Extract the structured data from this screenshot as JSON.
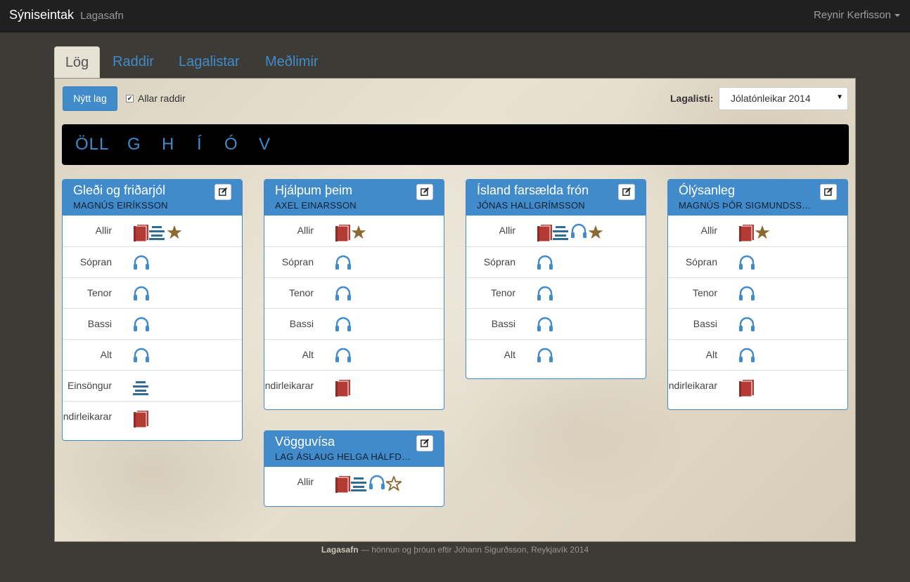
{
  "navbar": {
    "brand": "Sýniseintak",
    "subtitle": "Lagasafn",
    "user": "Reynir Kerfisson"
  },
  "tabs": [
    "Lög",
    "Raddir",
    "Lagalistar",
    "Meðlimir"
  ],
  "toolbar": {
    "new_song": "Nýtt lag",
    "all_voices": "Allar raddir",
    "all_voices_checked": true,
    "playlist_label": "Lagalisti:",
    "playlist_value": "Jólatónleikar 2014"
  },
  "letters": [
    "ÖLL",
    "G",
    "H",
    "Í",
    "Ó",
    "V"
  ],
  "colors": {
    "accent": "#428bca",
    "book": "#b33b36",
    "sheet": "#2f6c96",
    "star": "#8a6a32",
    "navbar": "#202020"
  },
  "songs": [
    {
      "title": "Gleði og friðarjól",
      "composer": "MAGNÚS EIRÍKSSON",
      "rows": [
        {
          "label": "Allir",
          "icons": [
            "book-icon",
            "sheet-music-icon",
            "star-icon"
          ]
        },
        {
          "label": "Sópran",
          "icons": [
            "headphones-icon"
          ]
        },
        {
          "label": "Tenor",
          "icons": [
            "headphones-icon"
          ]
        },
        {
          "label": "Bassi",
          "icons": [
            "headphones-icon"
          ]
        },
        {
          "label": "Alt",
          "icons": [
            "headphones-icon"
          ]
        },
        {
          "label": "Einsöngur",
          "icons": [
            "sheet-music-icon"
          ]
        },
        {
          "label": "Undirleikarar",
          "icons": [
            "book-icon"
          ]
        }
      ]
    },
    {
      "title": "Hjálpum þeim",
      "composer": "AXEL EINARSSON",
      "rows": [
        {
          "label": "Allir",
          "icons": [
            "book-icon",
            "star-icon"
          ]
        },
        {
          "label": "Sópran",
          "icons": [
            "headphones-icon"
          ]
        },
        {
          "label": "Tenor",
          "icons": [
            "headphones-icon"
          ]
        },
        {
          "label": "Bassi",
          "icons": [
            "headphones-icon"
          ]
        },
        {
          "label": "Alt",
          "icons": [
            "headphones-icon"
          ]
        },
        {
          "label": "Undirleikarar",
          "icons": [
            "book-icon"
          ]
        }
      ]
    },
    {
      "title": "Ísland farsælda frón",
      "composer": "JÓNAS HALLGRÍMSSON",
      "rows": [
        {
          "label": "Allir",
          "icons": [
            "book-icon",
            "sheet-music-icon",
            "headphones-icon",
            "star-icon"
          ]
        },
        {
          "label": "Sópran",
          "icons": [
            "headphones-icon"
          ]
        },
        {
          "label": "Tenor",
          "icons": [
            "headphones-icon"
          ]
        },
        {
          "label": "Bassi",
          "icons": [
            "headphones-icon"
          ]
        },
        {
          "label": "Alt",
          "icons": [
            "headphones-icon"
          ]
        }
      ]
    },
    {
      "title": "Ólýsanleg",
      "composer": "MAGNÚS ÞÓR SIGMUNDSS…",
      "rows": [
        {
          "label": "Allir",
          "icons": [
            "book-icon",
            "star-icon"
          ]
        },
        {
          "label": "Sópran",
          "icons": [
            "headphones-icon"
          ]
        },
        {
          "label": "Tenor",
          "icons": [
            "headphones-icon"
          ]
        },
        {
          "label": "Bassi",
          "icons": [
            "headphones-icon"
          ]
        },
        {
          "label": "Alt",
          "icons": [
            "headphones-icon"
          ]
        },
        {
          "label": "Undirleikarar",
          "icons": [
            "book-icon"
          ]
        }
      ]
    },
    {
      "title": "Vögguvísa",
      "composer": "LAG ÁSLAUG HELGA HÁLFD…",
      "rows": [
        {
          "label": "Allir",
          "icons": [
            "book-icon",
            "sheet-music-icon",
            "headphones-icon",
            "star-outline-icon"
          ]
        }
      ]
    }
  ],
  "footer": {
    "brand": "Lagasafn",
    "text": "— hönnun og þróun eftir Jóhann Sigurðsson, Reykjavík 2014"
  }
}
